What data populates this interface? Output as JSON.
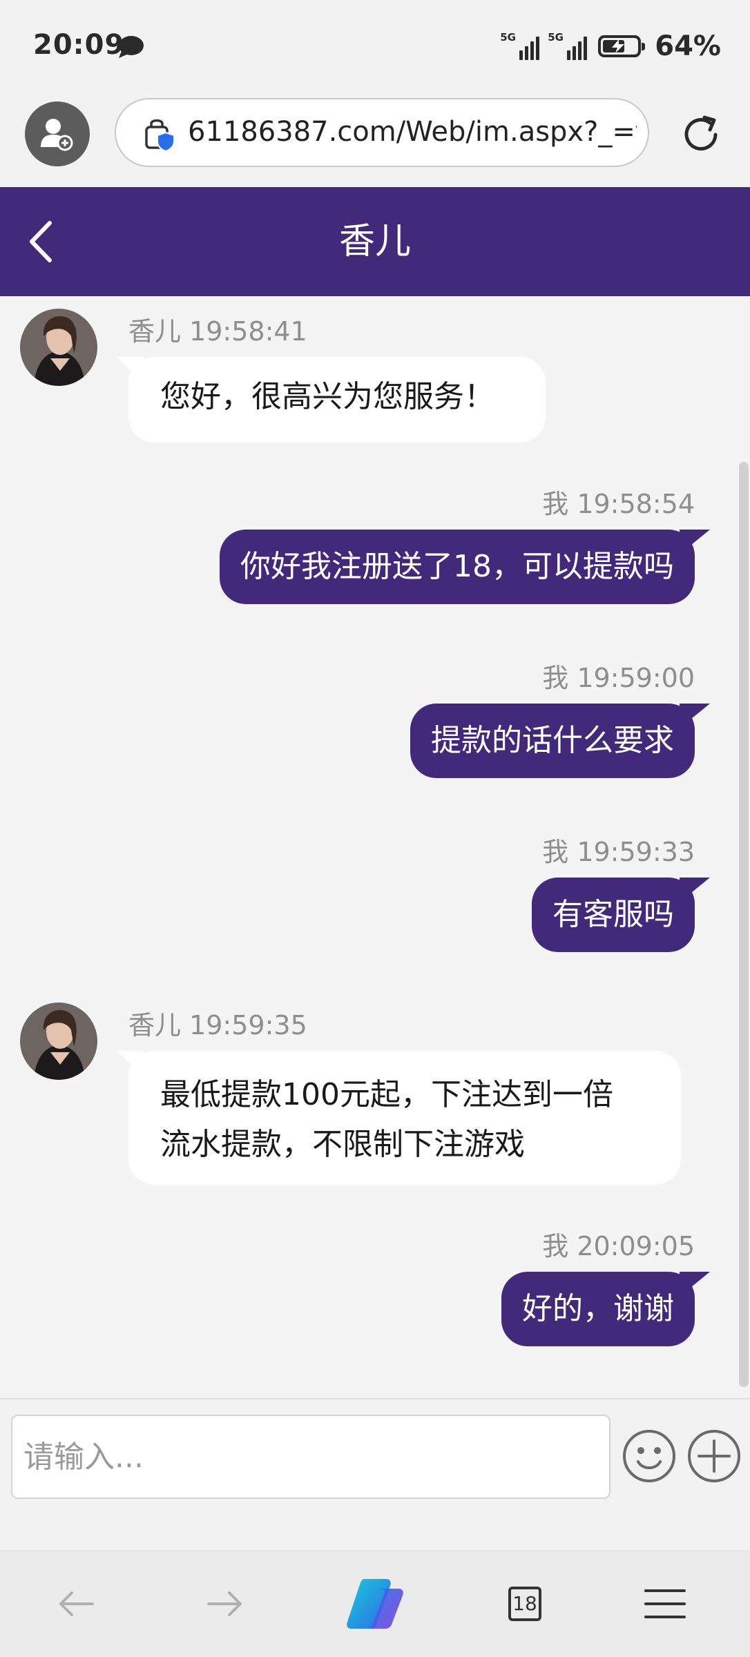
{
  "status_bar": {
    "time": "20:09",
    "network1": "5G",
    "network2": "5G",
    "battery_level": 0.64,
    "battery_percent": "64%"
  },
  "browser": {
    "url": "61186387.com/Web/im.aspx?_=t"
  },
  "chat": {
    "title": "香儿",
    "messages": [
      {
        "direction": "in",
        "sender": "香儿",
        "time": "19:58:41",
        "meta": "香儿 19:58:41",
        "text": "您好，很高兴为您服务！"
      },
      {
        "direction": "out",
        "sender": "我",
        "time": "19:58:54",
        "meta": "我 19:58:54",
        "text": "你好我注册送了18，可以提款吗"
      },
      {
        "direction": "out",
        "sender": "我",
        "time": "19:59:00",
        "meta": "我 19:59:00",
        "text": "提款的话什么要求"
      },
      {
        "direction": "out",
        "sender": "我",
        "time": "19:59:33",
        "meta": "我 19:59:33",
        "text": "有客服吗"
      },
      {
        "direction": "in",
        "sender": "香儿",
        "time": "19:59:35",
        "meta": "香儿 19:59:35",
        "line1": "最低提款100元起，下注达到一倍",
        "line2": "流水提款，不限制下注游戏"
      },
      {
        "direction": "out",
        "sender": "我",
        "time": "20:09:05",
        "meta": "我 20:09:05",
        "text": "好的，谢谢"
      }
    ]
  },
  "input": {
    "placeholder": "请输入..."
  },
  "bottom_nav": {
    "tab_count": "18",
    "icons": [
      "back-arrow-icon",
      "forward-arrow-icon",
      "copilot-icon",
      "tabs-icon",
      "menu-icon"
    ]
  },
  "colors": {
    "accent": "#43297a",
    "page_bg": "#f4f4f5",
    "bubble_in": "#ffffff",
    "meta_text": "#8e8e8e"
  }
}
